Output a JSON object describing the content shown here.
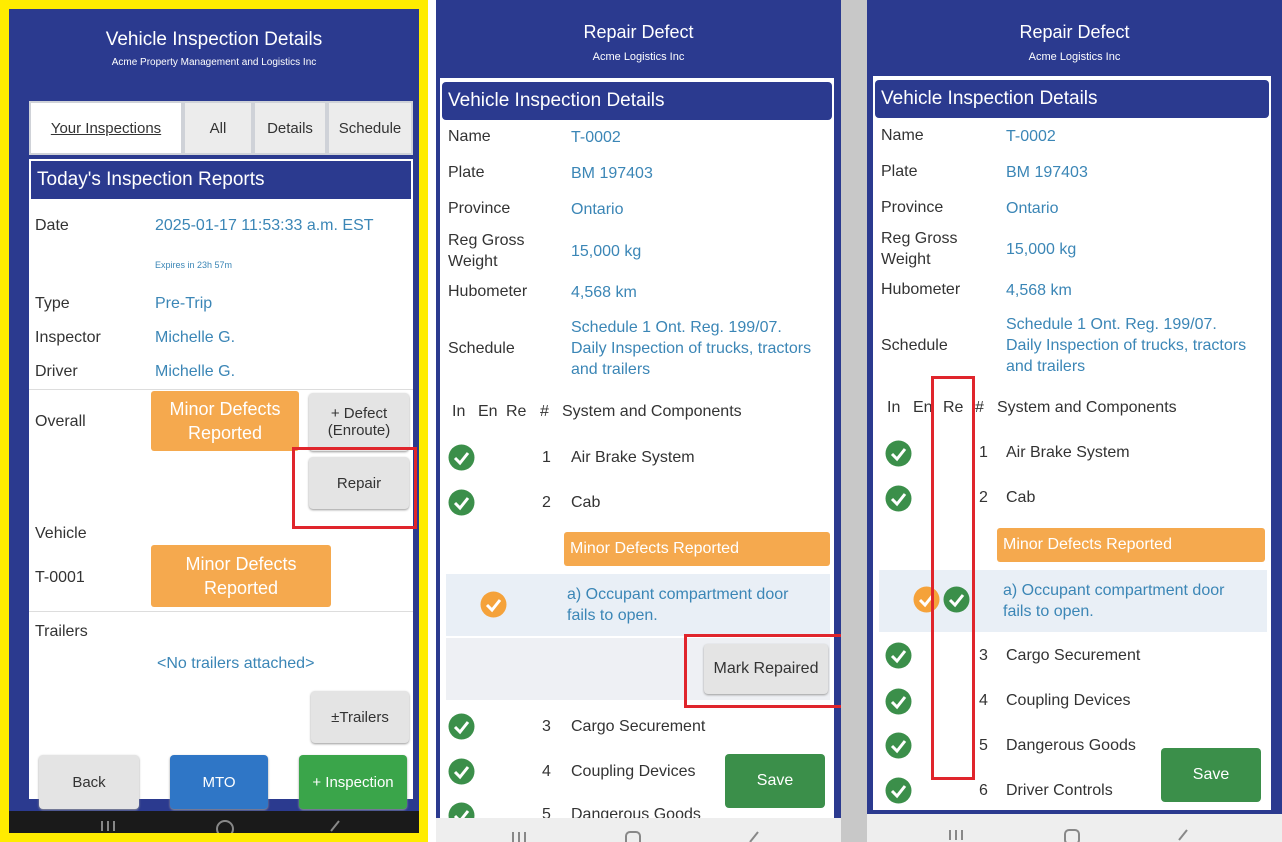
{
  "left": {
    "title": "Vehicle Inspection Details",
    "company": "Acme Property Management and Logistics Inc",
    "tabs": [
      "Your Inspections",
      "All",
      "Details",
      "Schedule"
    ],
    "section_title": "Today's Inspection Reports",
    "date_label": "Date",
    "date_value": "2025-01-17 11:53:33 a.m. EST",
    "expires": "Expires in 23h 57m",
    "type_label": "Type",
    "type_value": "Pre-Trip",
    "inspector_label": "Inspector",
    "inspector_value": "Michelle G.",
    "driver_label": "Driver",
    "driver_value": "Michelle G.",
    "overall_label": "Overall",
    "overall_status": "Minor Defects Reported",
    "defect_button": "+ Defect (Enroute)",
    "repair_button": "Repair",
    "vehicle_label": "Vehicle",
    "vehicle_id": "T-0001",
    "vehicle_status": "Minor Defects Reported",
    "trailers_label": "Trailers",
    "no_trailers": "<No trailers attached>",
    "trailers_button": "±Trailers",
    "back_button": "Back",
    "mto_button": "MTO",
    "inspection_button": "+ Inspection"
  },
  "middle": {
    "title": "Repair Defect",
    "company": "Acme Logistics Inc",
    "section_title": "Vehicle Inspection Details",
    "fields": [
      {
        "label": "Name",
        "value": "T-0002"
      },
      {
        "label": "Plate",
        "value": "BM 197403"
      },
      {
        "label": "Province",
        "value": "Ontario"
      },
      {
        "label": "Reg Gross Weight",
        "value": "15,000 kg"
      },
      {
        "label": "Hubometer",
        "value": "4,568 km"
      },
      {
        "label": "Schedule",
        "value": "Schedule 1 Ont. Reg. 199/07. Daily Inspection of trucks, tractors and trailers"
      }
    ],
    "col_in": "In",
    "col_en": "En",
    "col_re": "Re",
    "col_num": "#",
    "col_system": "System and Components",
    "items": [
      {
        "num": "1",
        "name": "Air Brake System"
      },
      {
        "num": "2",
        "name": "Cab"
      }
    ],
    "defect_status": "Minor Defects Reported",
    "defect_text": "a) Occupant compartment door fails to open.",
    "mark_repaired_button": "Mark Repaired",
    "items_after": [
      {
        "num": "3",
        "name": "Cargo Securement"
      },
      {
        "num": "4",
        "name": "Coupling Devices"
      },
      {
        "num": "5",
        "name": "Dangerous Goods"
      }
    ],
    "save_button": "Save"
  },
  "right": {
    "title": "Repair Defect",
    "company": "Acme Logistics Inc",
    "section_title": "Vehicle Inspection Details",
    "fields": [
      {
        "label": "Name",
        "value": "T-0002"
      },
      {
        "label": "Plate",
        "value": "BM 197403"
      },
      {
        "label": "Province",
        "value": "Ontario"
      },
      {
        "label": "Reg Gross Weight",
        "value": "15,000 kg"
      },
      {
        "label": "Hubometer",
        "value": "4,568 km"
      },
      {
        "label": "Schedule",
        "value": "Schedule 1 Ont. Reg. 199/07. Daily Inspection of trucks, tractors and trailers"
      }
    ],
    "col_in": "In",
    "col_en": "En",
    "col_re": "Re",
    "col_num": "#",
    "col_system": "System and Components",
    "items": [
      {
        "num": "1",
        "name": "Air Brake System"
      },
      {
        "num": "2",
        "name": "Cab"
      }
    ],
    "defect_status": "Minor Defects Reported",
    "defect_text": "a) Occupant compartment door fails to open.",
    "items_after": [
      {
        "num": "3",
        "name": "Cargo Securement"
      },
      {
        "num": "4",
        "name": "Coupling Devices"
      },
      {
        "num": "5",
        "name": "Dangerous Goods"
      },
      {
        "num": "6",
        "name": "Driver Controls"
      }
    ],
    "save_button": "Save"
  },
  "colors": {
    "header_blue": "#2b3a8f",
    "value_blue": "#3b86b6",
    "defect_orange": "#f5a94e",
    "check_green": "#3b8f4a",
    "highlight_red": "#e0252c",
    "frame_yellow": "#ffec00"
  }
}
